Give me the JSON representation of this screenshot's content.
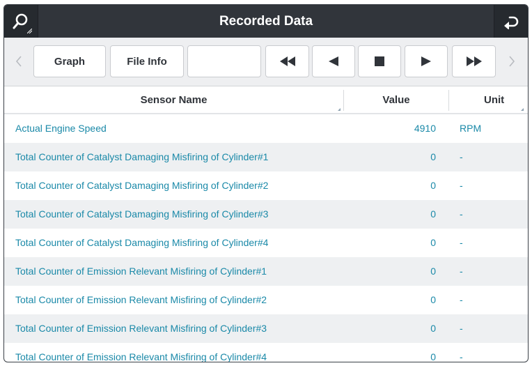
{
  "window": {
    "title": "Recorded Data"
  },
  "icons": {
    "search": "search-icon",
    "back": "return-icon"
  },
  "toolbar": {
    "graph_label": "Graph",
    "file_info_label": "File Info",
    "blank_label": ""
  },
  "table": {
    "headers": {
      "name": "Sensor Name",
      "value": "Value",
      "unit": "Unit"
    },
    "rows": [
      {
        "name": "Actual Engine Speed",
        "value": "4910",
        "unit": "RPM"
      },
      {
        "name": "Total Counter of Catalyst Damaging Misfiring of Cylinder#1",
        "value": "0",
        "unit": "-"
      },
      {
        "name": "Total Counter of Catalyst Damaging Misfiring of Cylinder#2",
        "value": "0",
        "unit": "-"
      },
      {
        "name": "Total Counter of Catalyst Damaging Misfiring of Cylinder#3",
        "value": "0",
        "unit": "-"
      },
      {
        "name": "Total Counter of Catalyst Damaging Misfiring of Cylinder#4",
        "value": "0",
        "unit": "-"
      },
      {
        "name": "Total Counter of Emission Relevant Misfiring of Cylinder#1",
        "value": "0",
        "unit": "-"
      },
      {
        "name": "Total Counter of Emission Relevant Misfiring of Cylinder#2",
        "value": "0",
        "unit": "-"
      },
      {
        "name": "Total Counter of Emission Relevant Misfiring of Cylinder#3",
        "value": "0",
        "unit": "-"
      },
      {
        "name": "Total Counter of Emission Relevant Misfiring of Cylinder#4",
        "value": "0",
        "unit": "-"
      }
    ]
  },
  "colors": {
    "header_bg": "#31353b",
    "row_text": "#1a89a8",
    "alt_row_bg": "#eef0f2"
  }
}
